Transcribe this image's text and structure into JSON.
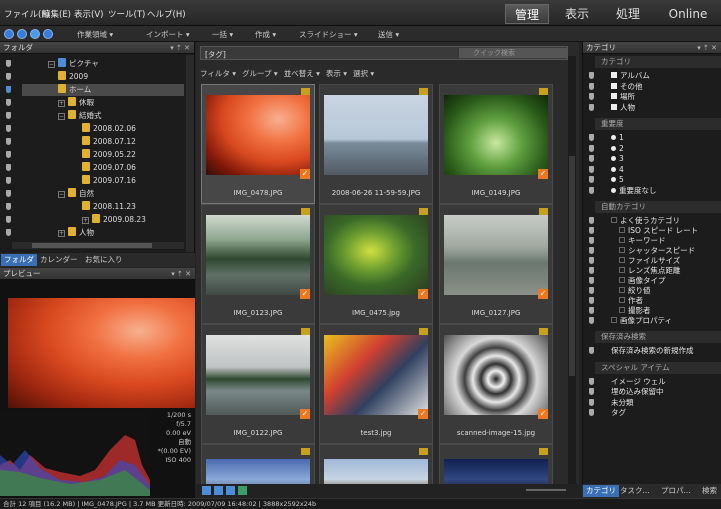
{
  "menu": [
    "ファイル(F)",
    "編集(E)",
    "表示(V)",
    "ツール(T)",
    "ヘルプ(H)"
  ],
  "modes": [
    "管理",
    "表示",
    "処理",
    "Online"
  ],
  "toolbar": [
    "作業領域 ▾",
    "インポート ▾",
    "一括 ▾",
    "作成 ▾",
    "スライドショー ▾",
    "送信 ▾"
  ],
  "folder_panel": {
    "title": "フォルダ",
    "controls": "▾ ⇡ ✕",
    "items": [
      {
        "label": "ピクチャ",
        "level": 0,
        "exp": "−"
      },
      {
        "label": "2009",
        "level": 1,
        "exp": ""
      },
      {
        "label": "ホーム",
        "level": 1,
        "exp": "",
        "selected": true
      },
      {
        "label": "休暇",
        "level": 1,
        "exp": "+"
      },
      {
        "label": "結婚式",
        "level": 1,
        "exp": "−"
      },
      {
        "label": "2008.02.06",
        "level": 2,
        "exp": ""
      },
      {
        "label": "2008.07.12",
        "level": 2,
        "exp": ""
      },
      {
        "label": "2009.05.22",
        "level": 2,
        "exp": ""
      },
      {
        "label": "2009.07.06",
        "level": 2,
        "exp": ""
      },
      {
        "label": "2009.07.16",
        "level": 2,
        "exp": ""
      },
      {
        "label": "自然",
        "level": 1,
        "exp": "−"
      },
      {
        "label": "2008.11.23",
        "level": 2,
        "exp": ""
      },
      {
        "label": "2009.08.23",
        "level": 2,
        "exp": "+"
      },
      {
        "label": "人物",
        "level": 1,
        "exp": "+"
      }
    ],
    "tabs": [
      "フォルダ",
      "カレンダー",
      "お気に入り"
    ]
  },
  "preview_panel": {
    "title": "プレビュー",
    "controls": "▾ ⇡ ✕",
    "exif": [
      "1/200 s",
      "f/5.7",
      "0.00 eV",
      "自動",
      "*(0.00 EV)",
      "ISO 400"
    ]
  },
  "grid": {
    "tag_field": "[タグ]",
    "search_placeholder": "クイック検索",
    "filterbar": [
      "フィルタ ▾",
      "グループ ▾",
      "並べ替え ▾",
      "表示 ▾",
      "選択 ▾"
    ],
    "items": [
      {
        "caption": "IMG_0478.JPG",
        "kind": "flamingo",
        "selected": true,
        "checked": true
      },
      {
        "caption": "2008-06-26 11-59-59.JPG",
        "kind": "ship",
        "selected": false,
        "checked": false
      },
      {
        "caption": "IMG_0149.JPG",
        "kind": "waterfall",
        "selected": false,
        "checked": true
      },
      {
        "caption": "IMG_0123.JPG",
        "kind": "lake",
        "selected": false,
        "checked": true
      },
      {
        "caption": "IMG_0475.jpg",
        "kind": "parrot",
        "selected": false,
        "checked": true
      },
      {
        "caption": "IMG_0127.JPG",
        "kind": "foglake",
        "selected": false,
        "checked": true
      },
      {
        "caption": "IMG_0122.JPG",
        "kind": "shore",
        "selected": false,
        "checked": true
      },
      {
        "caption": "test3.jpg",
        "kind": "motorbike",
        "selected": false,
        "checked": true
      },
      {
        "caption": "scanned-image-15.jpg",
        "kind": "stairs",
        "selected": false,
        "checked": true
      },
      {
        "caption": "",
        "kind": "sky",
        "selected": false,
        "checked": false
      },
      {
        "caption": "",
        "kind": "tower",
        "selected": false,
        "checked": false
      },
      {
        "caption": "",
        "kind": "night",
        "selected": false,
        "checked": false
      }
    ]
  },
  "right_panel": {
    "title": "カテゴリ",
    "controls": "▾ ⇡ ✕",
    "sections": [
      {
        "header": "カテゴリ",
        "items": [
          {
            "t": "アルバム",
            "m": "chk"
          },
          {
            "t": "その他",
            "m": "chk"
          },
          {
            "t": "場所",
            "m": "chk"
          },
          {
            "t": "人物",
            "m": "chk"
          }
        ]
      },
      {
        "header": "重要度",
        "items": [
          {
            "t": "1",
            "m": "dot"
          },
          {
            "t": "2",
            "m": "dot"
          },
          {
            "t": "3",
            "m": "dot"
          },
          {
            "t": "4",
            "m": "dot"
          },
          {
            "t": "5",
            "m": "dot"
          },
          {
            "t": "重要度なし",
            "m": "dot"
          }
        ]
      },
      {
        "header": "自動カテゴリ",
        "items": [
          {
            "t": "よく使うカテゴリ",
            "m": "plus"
          },
          {
            "t": "ISO スピード レート",
            "m": "plus",
            "sub": true
          },
          {
            "t": "キーワード",
            "m": "plus",
            "sub": true
          },
          {
            "t": "シャッタースピード",
            "m": "plus",
            "sub": true
          },
          {
            "t": "ファイルサイズ",
            "m": "plus",
            "sub": true
          },
          {
            "t": "レンズ焦点距離",
            "m": "plus",
            "sub": true
          },
          {
            "t": "画像タイプ",
            "m": "plus",
            "sub": true
          },
          {
            "t": "絞り値",
            "m": "plus",
            "sub": true
          },
          {
            "t": "作者",
            "m": "plus",
            "sub": true
          },
          {
            "t": "撮影者",
            "m": "plus",
            "sub": true
          },
          {
            "t": "画像プロパティ",
            "m": "plus"
          }
        ]
      },
      {
        "header": "保存済み検索",
        "items": [
          {
            "t": "保存済み検索の新規作成",
            "m": ""
          }
        ]
      },
      {
        "header": "スペシャル アイテム",
        "items": [
          {
            "t": "イメージ ウェル",
            "m": ""
          },
          {
            "t": "埋め込み保留中",
            "m": ""
          },
          {
            "t": "未分類",
            "m": ""
          },
          {
            "t": "タグ",
            "m": ""
          }
        ]
      }
    ],
    "tabs": [
      "カテゴリ",
      "タスク...",
      "プロパ...",
      "検索"
    ]
  },
  "status": "合計 12 項目 (16.2 MB)  |  IMG_0478.JPG  |  3.7 MB  更新日時: 2009/07/09 16:48:02  |  3888x2592x24b",
  "colors": {
    "accent": "#3a6eb5",
    "check": "#f07820",
    "folder": "#e0b030"
  }
}
